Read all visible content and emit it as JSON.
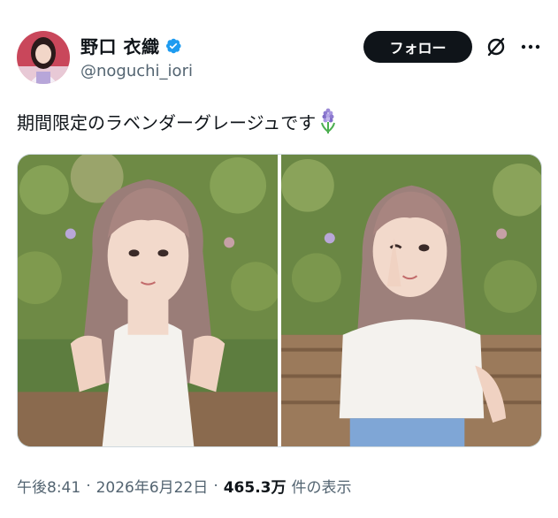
{
  "author": {
    "display_name": "野口 衣織",
    "handle": "@noguchi_iori",
    "verified": true
  },
  "actions": {
    "follow_label": "フォロー",
    "grok_icon": "grok-slash-icon",
    "more_icon": "more-dots-icon"
  },
  "tweet": {
    "text": "期間限定のラベンダーグレージュです",
    "emoji_icon": "hyacinth-icon"
  },
  "media": {
    "count": 2
  },
  "meta": {
    "time": "午後8:41",
    "separator": "·",
    "date": "2026年6月22日",
    "views_count": "465.3万",
    "views_label": "件の表示"
  },
  "colors": {
    "text_primary": "#0f1419",
    "text_secondary": "#536471",
    "verified_blue": "#1d9bf0",
    "follow_bg": "#0f1419",
    "border": "#cfd9de"
  }
}
